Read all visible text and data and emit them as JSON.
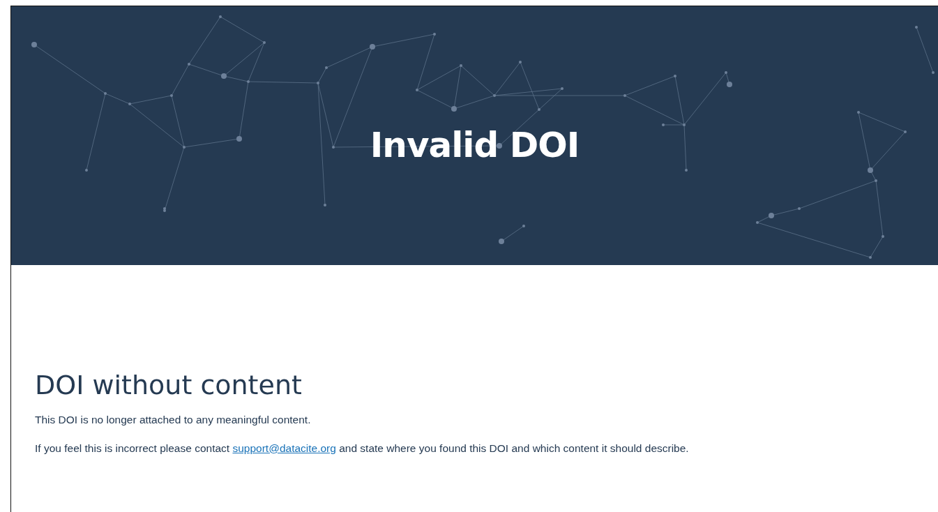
{
  "banner": {
    "title": "Invalid DOI"
  },
  "content": {
    "heading": "DOI without content",
    "paragraphs": [
      {
        "text": "This DOI is no longer attached to any meaningful content."
      },
      {
        "text": "If you feel this is incorrect please contact",
        "link": "support@datacite.org",
        "after": "and state where you found this DOI and which content it should describe."
      }
    ]
  }
}
